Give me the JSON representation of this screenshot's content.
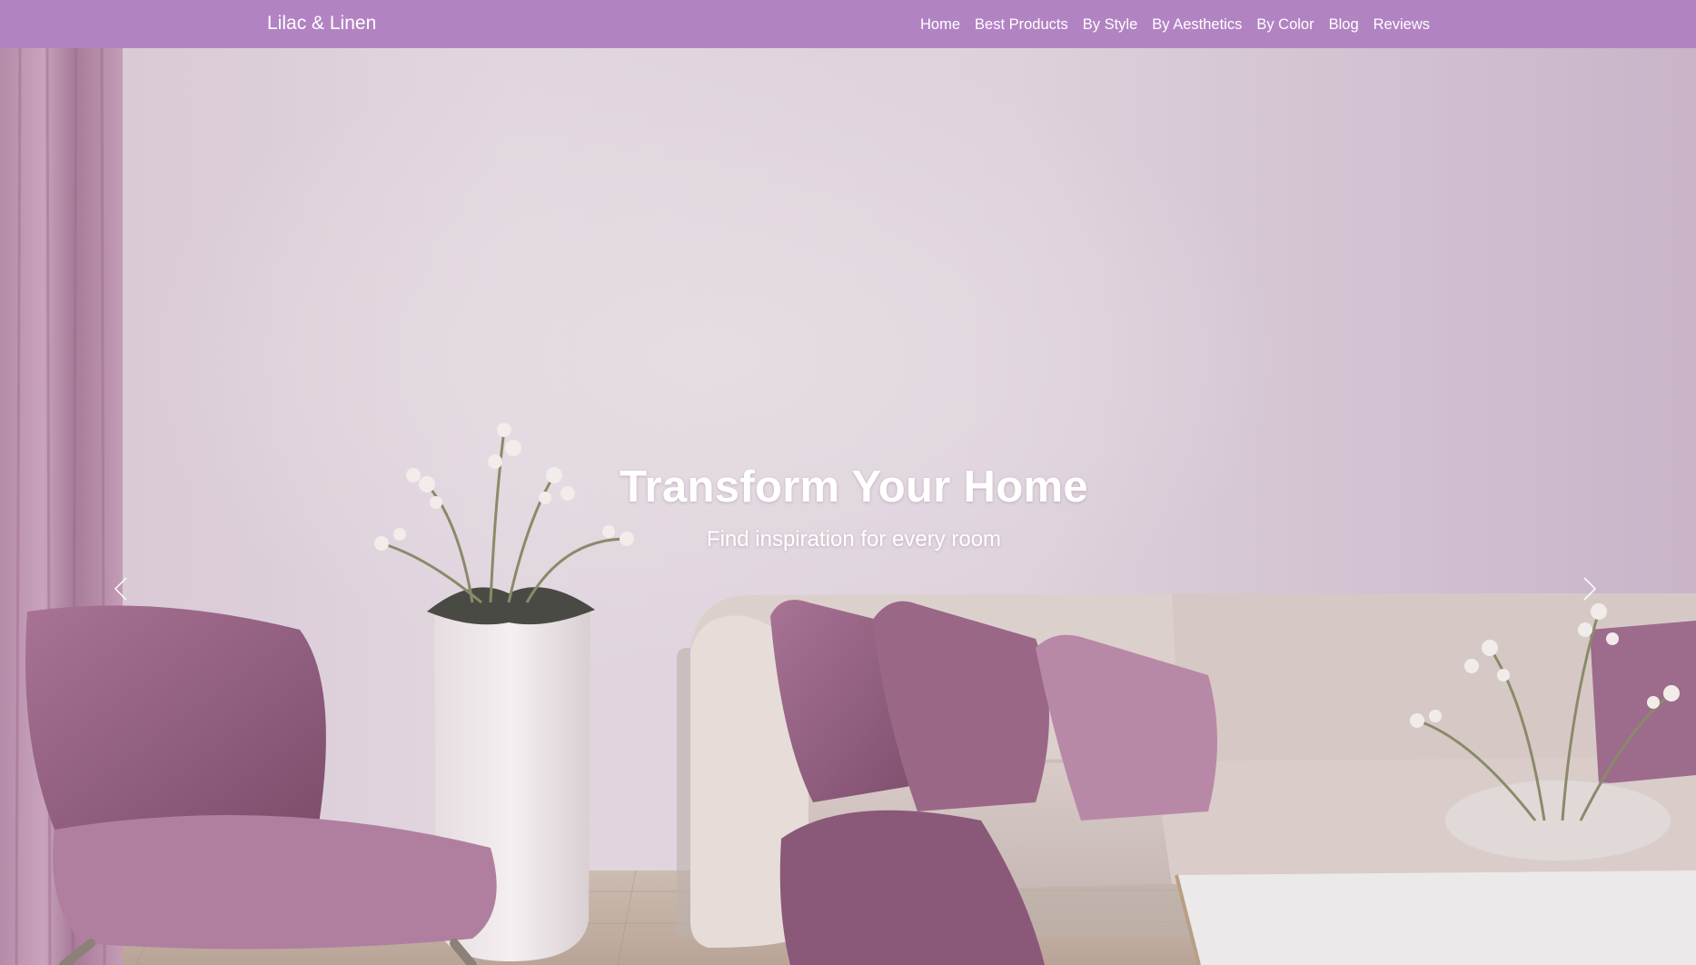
{
  "navbar": {
    "brand": "Lilac & Linen",
    "links": [
      {
        "label": "Home"
      },
      {
        "label": "Best Products"
      },
      {
        "label": "By Style"
      },
      {
        "label": "By Aesthetics"
      },
      {
        "label": "By Color"
      },
      {
        "label": "Blog"
      },
      {
        "label": "Reviews"
      }
    ]
  },
  "hero": {
    "title": "Transform Your Home",
    "subtitle": "Find inspiration for every room",
    "prev_icon": "chevron-left-icon",
    "next_icon": "chevron-right-icon"
  },
  "colors": {
    "navbar_bg": "#b283c2",
    "text": "#ffffff",
    "accent_plum": "#8a5878"
  }
}
